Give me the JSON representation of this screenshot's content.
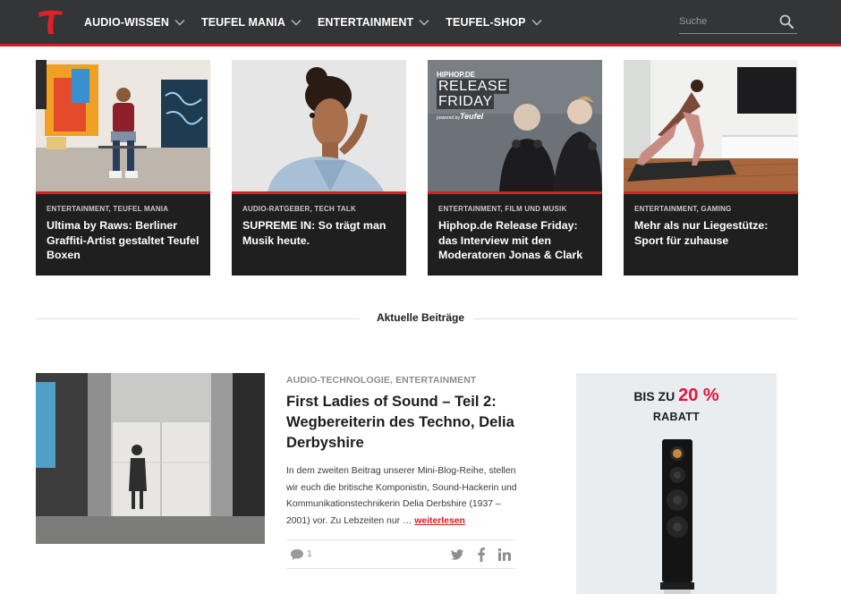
{
  "header": {
    "logo_letter": "T",
    "nav": [
      {
        "label": "AUDIO-WISSEN"
      },
      {
        "label": "TEUFEL MANIA"
      },
      {
        "label": "ENTERTAINMENT"
      },
      {
        "label": "TEUFEL-SHOP"
      }
    ],
    "search": {
      "placeholder": "Suche"
    }
  },
  "featured": [
    {
      "category": "ENTERTAINMENT, TEUFEL MANIA",
      "title": "Ultima by Raws: Berliner Graffiti-Artist gestaltet Teufel Boxen"
    },
    {
      "category": "AUDIO-RATGEBER, TECH TALK",
      "title": "SUPREME IN: So trägt man Musik heute."
    },
    {
      "category": "ENTERTAINMENT, FILM UND MUSIK",
      "title": "Hiphop.de Release Friday: das Interview mit den Moderatoren Jonas & Clark",
      "image_text": {
        "brand": "HIPHOP.DE",
        "line1": "RELEASE",
        "line2": "FRIDAY",
        "powered": "powered by",
        "powered_brand": "Teufel"
      }
    },
    {
      "category": "ENTERTAINMENT, GAMING",
      "title": "Mehr als nur Liegestütze: Sport für zuhause"
    }
  ],
  "section": {
    "title": "Aktuelle Beiträge"
  },
  "article": {
    "category": "AUDIO-TECHNOLOGIE, ENTERTAINMENT",
    "title": "First Ladies of Sound – Teil 2: Wegbereiterin des Techno, Delia Derbyshire",
    "excerpt": "In dem zweiten Beitrag unserer Mini-Blog-Reihe, stellen wir euch die britische Komponistin, Sound-Hackerin und Kommunikationstechnikerin Delia Derbshire (1937 – 2001) vor. Zu Lebzeiten nur …",
    "read_more": "weiterlesen",
    "comments": "1",
    "share_icons": [
      "twitter-icon",
      "facebook-icon",
      "linkedin-icon"
    ]
  },
  "ad": {
    "prefix": "BIS ZU",
    "percent": "20 %",
    "line2": "RABATT"
  },
  "colors": {
    "brand_red": "#d31f26",
    "header_bg": "#343537",
    "card_bg": "#1f1f1f",
    "ad_bg": "#e9edf0",
    "ad_accent": "#e3153d"
  }
}
